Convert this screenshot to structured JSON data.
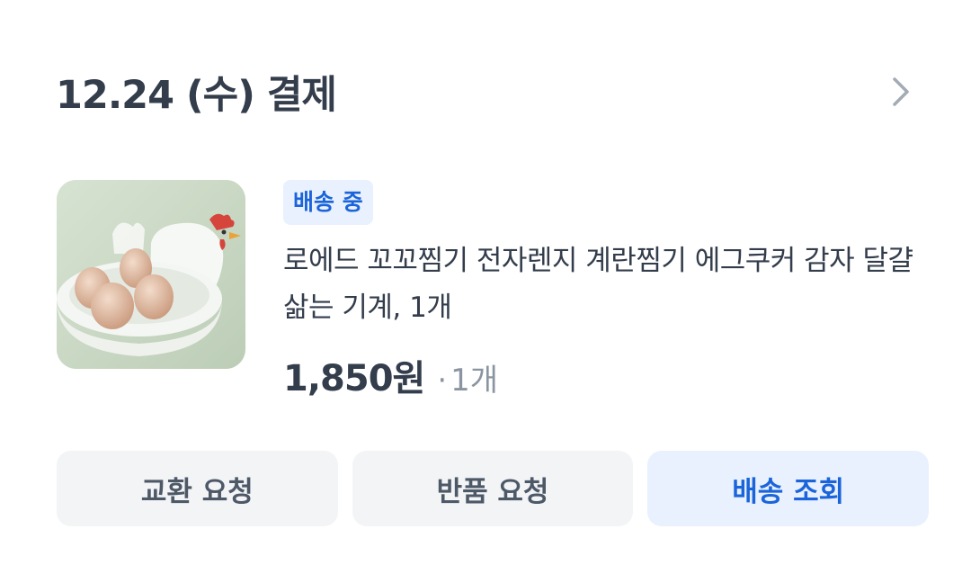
{
  "order": {
    "date_label": "12.24 (수) 결제"
  },
  "item": {
    "status": "배송 중",
    "name": "로에드 꼬꼬찜기 전자렌지 계란찜기 에그쿠커 감자 달걀 삶는 기계, 1개",
    "price": "1,850원",
    "separator": "·",
    "quantity": "1개",
    "image_icon": "egg-cooker-product-image"
  },
  "actions": {
    "exchange_label": "교환 요청",
    "return_label": "반품 요청",
    "track_label": "배송 조회"
  },
  "colors": {
    "accent": "#1b64da",
    "accent_bg": "#e8f1fd",
    "button_bg": "#f2f4f6",
    "text_primary": "#333d4b",
    "text_secondary": "#8b95a1"
  }
}
